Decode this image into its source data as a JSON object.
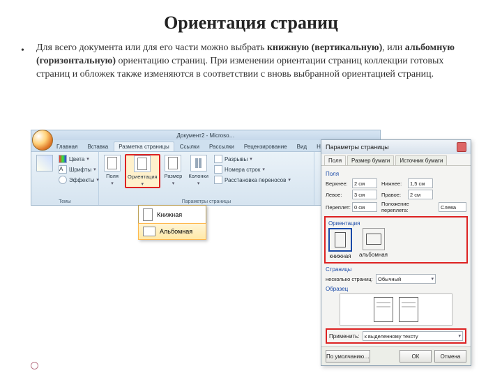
{
  "slide": {
    "title": "Ориентация страниц",
    "bullet": "•",
    "paragraph_parts": {
      "t1": "Для всего документа или для его части можно выбрать ",
      "b1": "книжную (вертикальную)",
      "t2": ", или ",
      "b2": "альбомную (горизонтальную)",
      "t3": " ориентацию страниц. При изменении ориентации страниц коллекции готовых страниц и обложек также изменяются в соответствии с вновь выбранной ориентацией страниц."
    }
  },
  "ribbon": {
    "doc_title": "Документ2 - Microso…",
    "tabs": [
      "Главная",
      "Вставка",
      "Разметка страницы",
      "Ссылки",
      "Рассылки",
      "Рецензирование",
      "Вид",
      "Надстройки"
    ],
    "active_tab": "Разметка страницы",
    "themes": {
      "label_group": "Темы",
      "colors": "Цвета",
      "fonts": "Шрифты",
      "effects": "Эффекты"
    },
    "page_setup": {
      "margins": "Поля",
      "orientation": "Ориентация",
      "size": "Размер",
      "columns": "Колонки",
      "breaks": "Разрывы",
      "line_numbers": "Номера строк",
      "hyphenation": "Расстановка переносов",
      "group_label": "Параметры страницы"
    }
  },
  "orient_dropdown": {
    "portrait": "Книжная",
    "landscape": "Альбомная"
  },
  "dialog": {
    "title": "Параметры страницы",
    "tabs": [
      "Поля",
      "Размер бумаги",
      "Источник бумаги"
    ],
    "margins_section": "Поля",
    "fields": {
      "top_l": "Верхнее:",
      "top_v": "2 см",
      "bottom_l": "Нижнее:",
      "bottom_v": "1,5 см",
      "left_l": "Левое:",
      "left_v": "3 см",
      "right_l": "Правое:",
      "right_v": "2 см",
      "gutter_l": "Переплет:",
      "gutter_v": "0 см",
      "gutter_pos_l": "Положение переплета:",
      "gutter_pos_v": "Слева"
    },
    "orientation_section": "Ориентация",
    "orient_portrait": "книжная",
    "orient_landscape": "альбомная",
    "pages_section": "Страницы",
    "pages_label": "несколько страниц:",
    "pages_value": "Обычный",
    "preview_section": "Образец",
    "apply_label": "Применить:",
    "apply_value": "к выделенному тексту",
    "default_btn": "По умолчанию…",
    "ok": "ОК",
    "cancel": "Отмена"
  }
}
